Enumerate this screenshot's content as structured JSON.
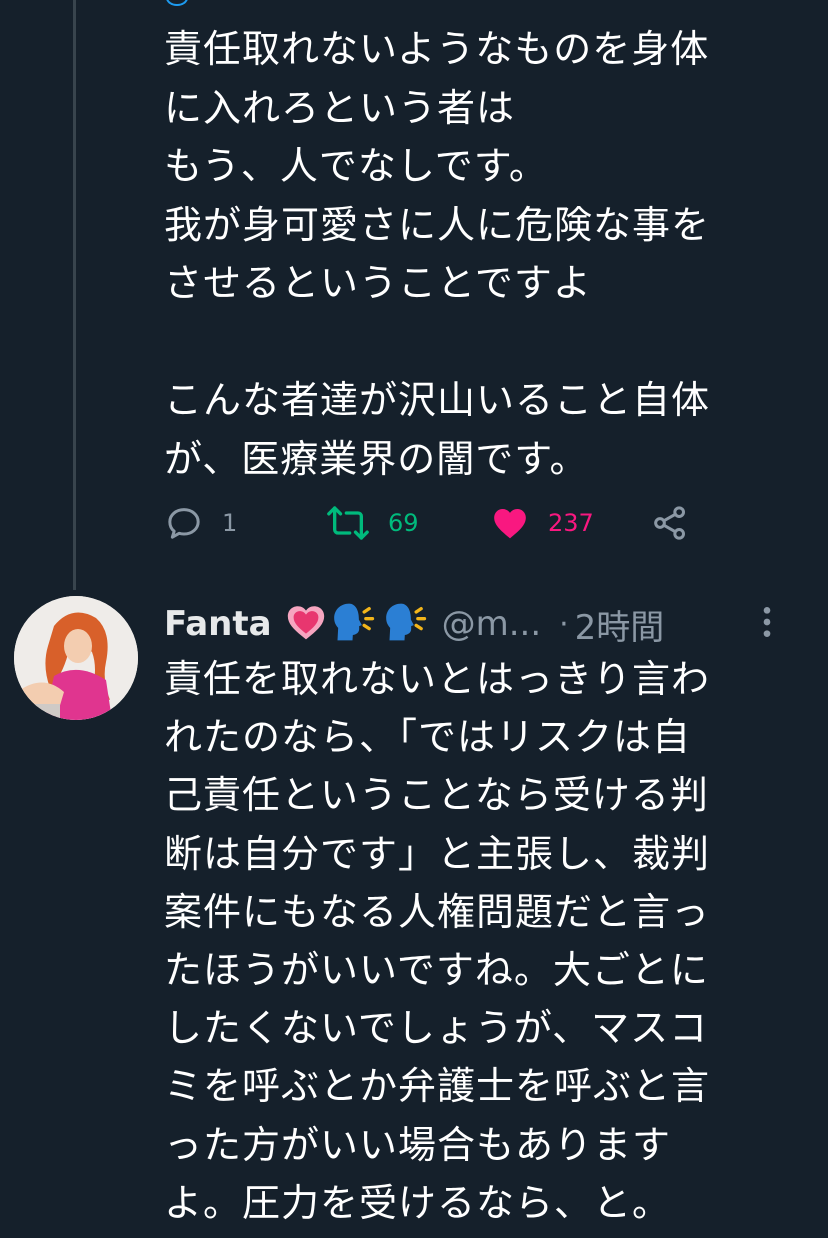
{
  "tweet1": {
    "text": "責任取れないようなものを身体\nに入れろという者は\nもう、人でなしです。\n我が身可愛さに人に危険な事を\nさせるということですよ\n\nこんな者達が沢山いること自体\nが、医療業界の闇です。",
    "replies": "1",
    "retweets": "69",
    "likes": "237",
    "icons": [
      "reply-icon",
      "retweet-icon",
      "heart-icon",
      "share-icon"
    ],
    "colors": {
      "retweet": "#00ba7c",
      "like": "#f91880",
      "muted": "#8b98a5"
    }
  },
  "tweet2": {
    "display_name": "Fanta",
    "emoji_icons": [
      "heart-emoji",
      "speaking-head-emoji",
      "speaking-head-emoji"
    ],
    "handle": "@m...",
    "separator": "·",
    "time": "2時間",
    "text": "責任を取れないとはっきり言わ\nれたのなら、「ではリスクは自\n己責任ということなら受ける判\n断は自分です」と主張し、裁判\n案件にもなる人権問題だと言っ\nたほうがいいですね。大ごとに\nしたくないでしょうが、マスコ\nミを呼ぶとか弁護士を呼ぶと言\nった方がいい場合もあります\nよ。圧力を受けるなら、と。"
  },
  "theme": {
    "background": "#15202b",
    "text": "#ffffff",
    "thread_line": "#38444d",
    "accent": "#1d9bf0"
  }
}
